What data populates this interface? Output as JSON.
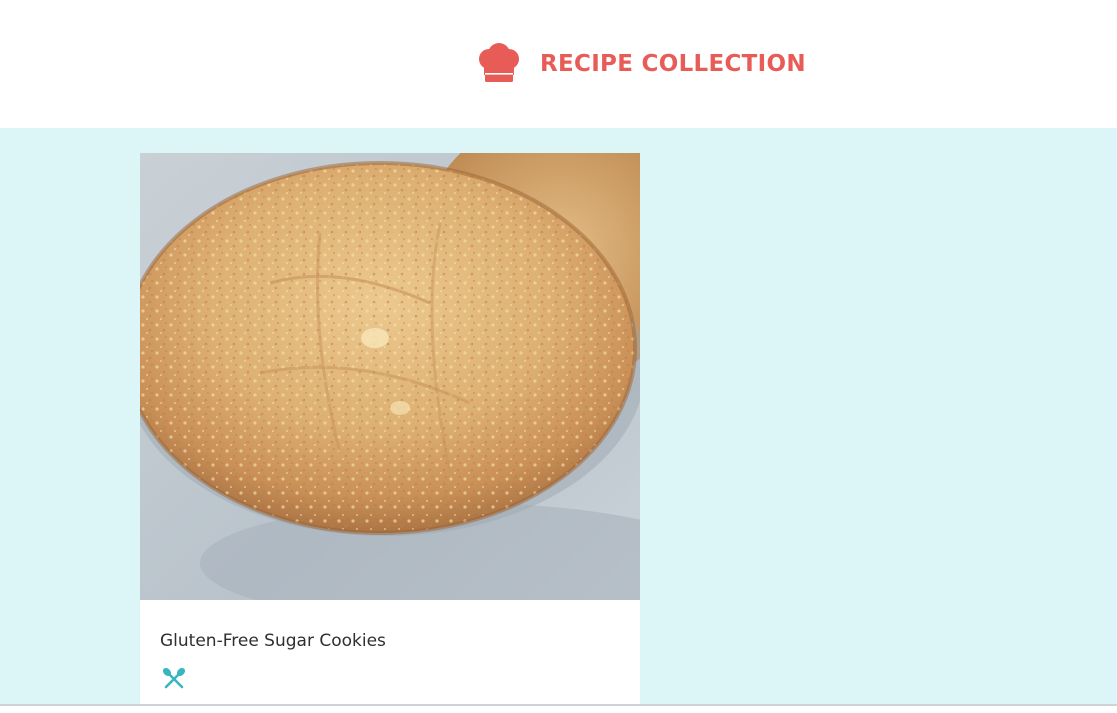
{
  "header": {
    "title": "RECIPE COLLECTION",
    "logo_icon": "chef-hat-icon",
    "accent_color": "#e85c58"
  },
  "main": {
    "background_color": "#dcf6f7",
    "recipes": [
      {
        "title": "Gluten-Free Sugar Cookies",
        "image": "cookie-photo",
        "icon": "utensils-icon",
        "icon_color": "#3ab5bf"
      }
    ]
  }
}
